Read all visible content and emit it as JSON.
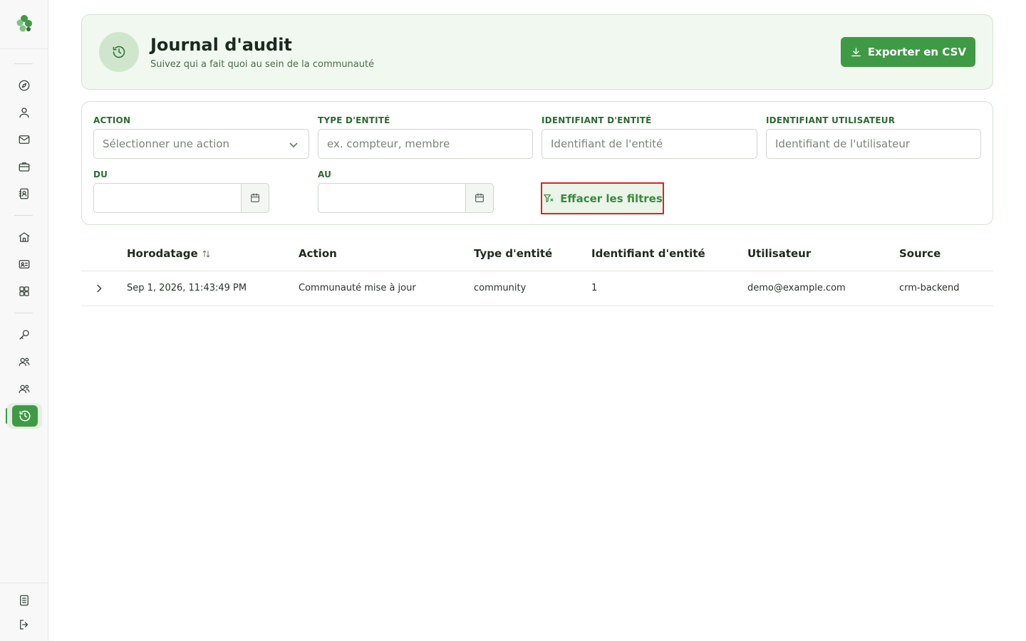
{
  "sidebar": {
    "logo": "clover-logo",
    "items": [
      {
        "icon": "compass-icon",
        "name": "sidebar-item-explore"
      },
      {
        "icon": "user-icon",
        "name": "sidebar-item-profile"
      },
      {
        "icon": "mail-icon",
        "name": "sidebar-item-messages"
      },
      {
        "icon": "briefcase-icon",
        "name": "sidebar-item-work"
      },
      {
        "icon": "contact-book-icon",
        "name": "sidebar-item-contacts"
      },
      {
        "icon": "bank-icon",
        "name": "sidebar-item-institution"
      },
      {
        "icon": "id-card-icon",
        "name": "sidebar-item-members"
      },
      {
        "icon": "grid-icon",
        "name": "sidebar-item-apps"
      },
      {
        "icon": "key-icon",
        "name": "sidebar-item-access"
      },
      {
        "icon": "users-icon",
        "name": "sidebar-item-groups"
      },
      {
        "icon": "users-alt-icon",
        "name": "sidebar-item-teams"
      },
      {
        "icon": "history-icon",
        "name": "sidebar-item-audit",
        "active": true
      }
    ],
    "bottom": [
      {
        "icon": "document-icon",
        "name": "sidebar-item-docs"
      },
      {
        "icon": "logout-icon",
        "name": "sidebar-item-logout"
      }
    ]
  },
  "header": {
    "title": "Journal d'audit",
    "subtitle": "Suivez qui a fait quoi au sein de la communauté",
    "export_label": "Exporter en CSV"
  },
  "filters": {
    "action_label": "ACTION",
    "action_placeholder": "Sélectionner une action",
    "entity_type_label": "TYPE D'ENTITÉ",
    "entity_type_placeholder": "ex. compteur, membre",
    "entity_id_label": "IDENTIFIANT D'ENTITÉ",
    "entity_id_placeholder": "Identifiant de l'entité",
    "user_id_label": "IDENTIFIANT UTILISATEUR",
    "user_id_placeholder": "Identifiant de l'utilisateur",
    "from_label": "DU",
    "to_label": "AU",
    "clear_label": "Effacer les filtres"
  },
  "table": {
    "columns": [
      "Horodatage",
      "Action",
      "Type d'entité",
      "Identifiant d'entité",
      "Utilisateur",
      "Source"
    ],
    "rows": [
      [
        "Sep 1, 2026, 11:43:49 PM",
        "Communauté mise à jour",
        "community",
        "1",
        "demo@example.com",
        "crm-backend"
      ]
    ]
  },
  "colors": {
    "primary": "#3f9a45",
    "header_bg": "#f1f8f0",
    "highlight_border": "#d9232a"
  }
}
